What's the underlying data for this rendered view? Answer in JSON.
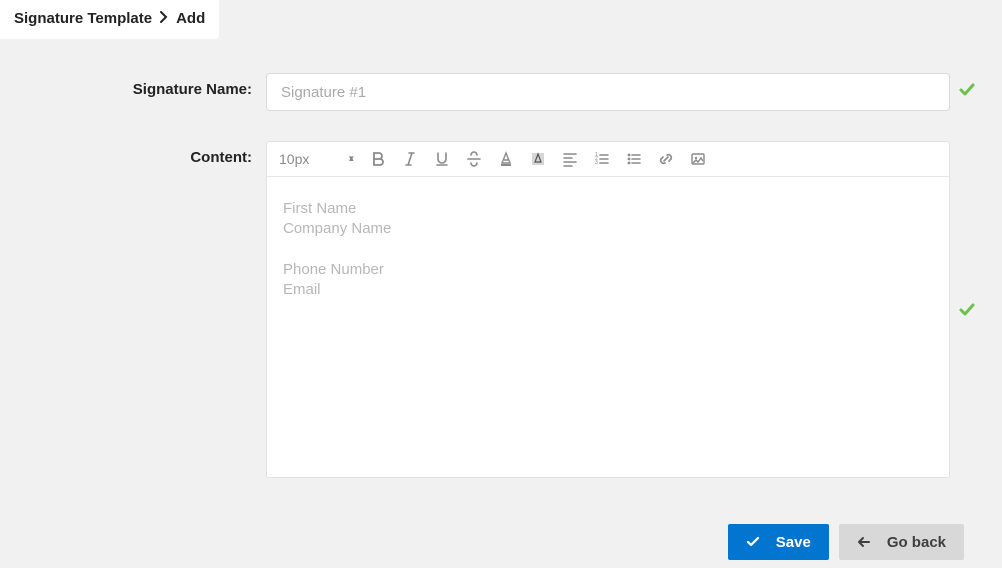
{
  "breadcrumb": {
    "root": "Signature Template",
    "current": "Add"
  },
  "form": {
    "name_label": "Signature Name:",
    "name_placeholder": "Signature #1",
    "content_label": "Content:"
  },
  "toolbar": {
    "fontsize": "10px"
  },
  "editor_placeholder": {
    "first_name": "First Name",
    "company": "Company Name",
    "phone": "Phone Number",
    "email": "Email"
  },
  "actions": {
    "save": "Save",
    "goback": "Go back"
  }
}
